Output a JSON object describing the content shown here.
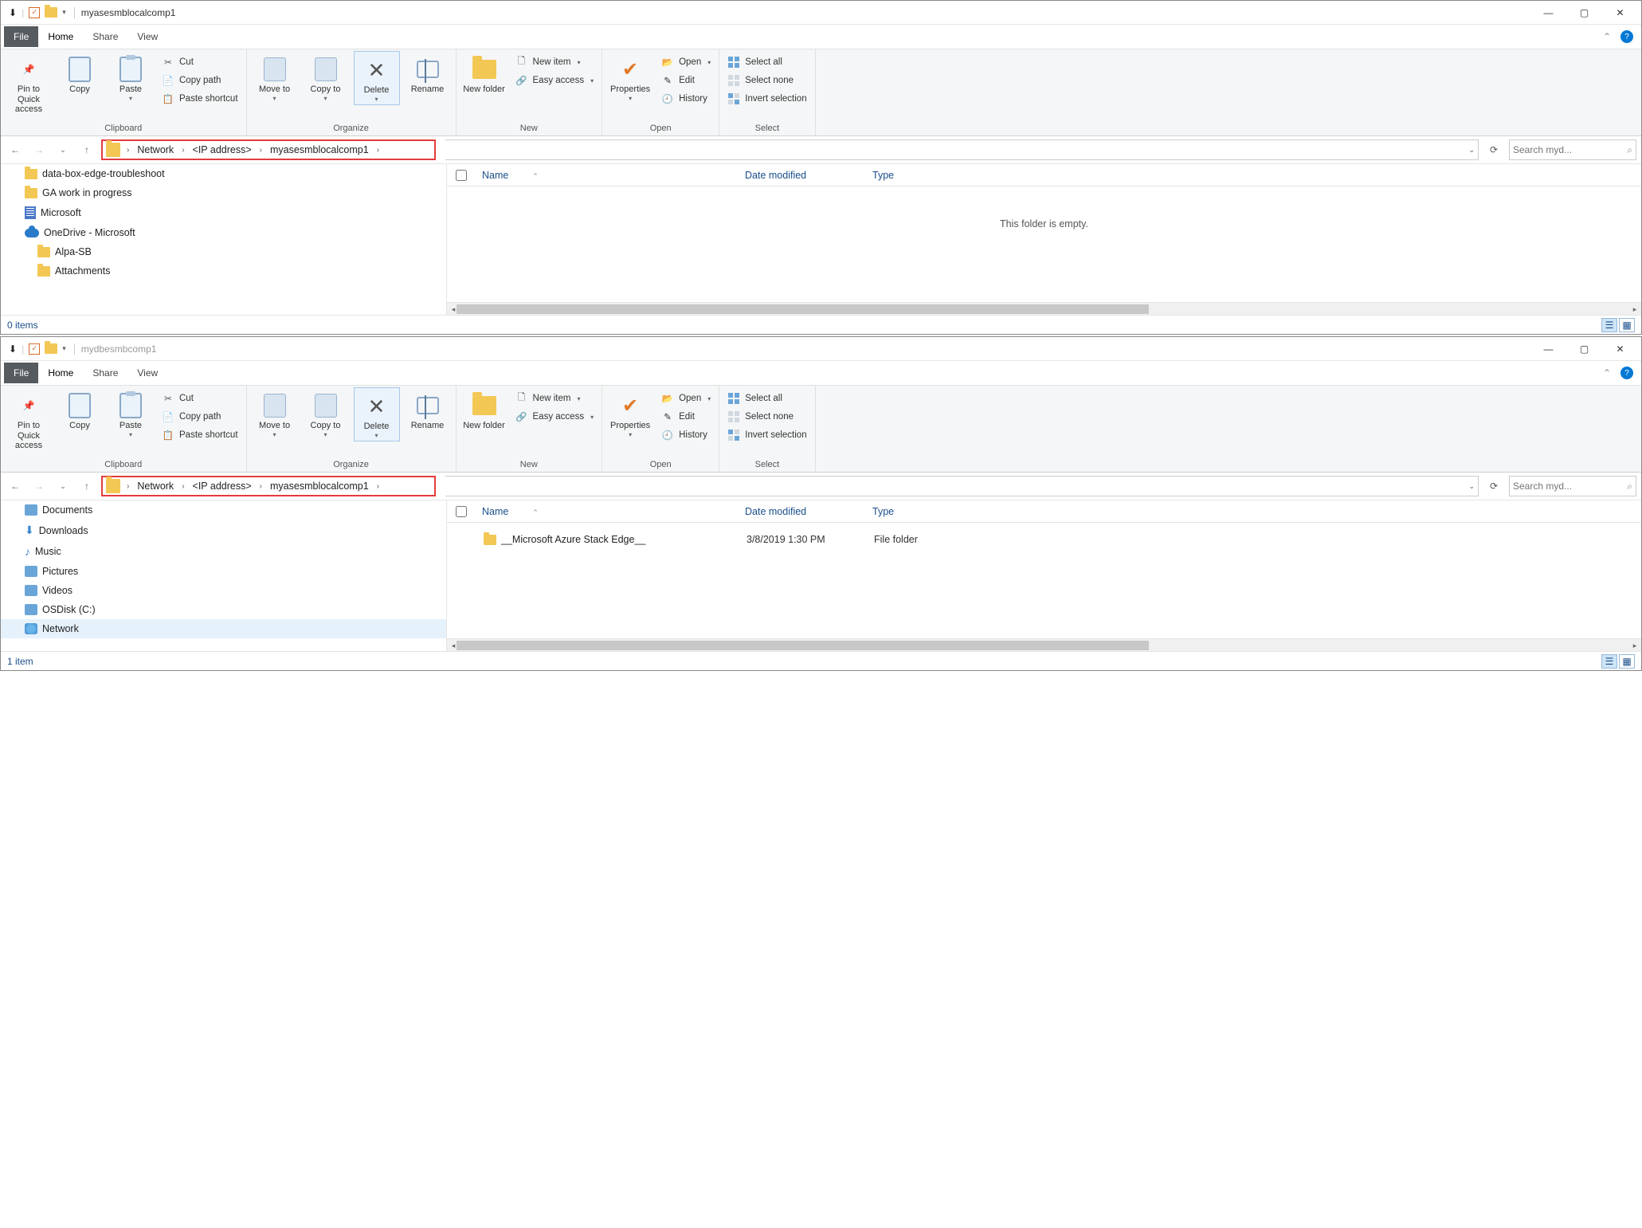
{
  "windows": [
    {
      "title": "myasesmblocalcomp1",
      "dimmed": false,
      "tabs": {
        "file": "File",
        "home": "Home",
        "share": "Share",
        "view": "View"
      },
      "ribbon": {
        "clipboard": {
          "label": "Clipboard",
          "pin": "Pin to Quick access",
          "copy": "Copy",
          "paste": "Paste",
          "cut": "Cut",
          "copypath": "Copy path",
          "pasteshortcut": "Paste shortcut"
        },
        "organize": {
          "label": "Organize",
          "moveto": "Move to",
          "copyto": "Copy to",
          "delete": "Delete",
          "rename": "Rename"
        },
        "new": {
          "label": "New",
          "newfolder": "New folder",
          "newitem": "New item",
          "easyaccess": "Easy access"
        },
        "open": {
          "label": "Open",
          "properties": "Properties",
          "open": "Open",
          "edit": "Edit",
          "history": "History"
        },
        "select": {
          "label": "Select",
          "all": "Select all",
          "none": "Select none",
          "invert": "Invert selection"
        }
      },
      "breadcrumb": [
        {
          "label": "Network"
        },
        {
          "label": "<IP address>"
        },
        {
          "label": "myasesmblocalcomp1"
        }
      ],
      "search_placeholder": "Search myd...",
      "columns": {
        "name": "Name",
        "date": "Date modified",
        "type": "Type"
      },
      "nav_items": [
        {
          "icon": "folder",
          "label": "data-box-edge-troubleshoot",
          "indent": false
        },
        {
          "icon": "folder",
          "label": "GA work in progress",
          "indent": false
        },
        {
          "icon": "building",
          "label": "Microsoft",
          "indent": false
        },
        {
          "icon": "cloud",
          "label": "OneDrive - Microsoft",
          "indent": false
        },
        {
          "icon": "folder",
          "label": "Alpa-SB",
          "indent": true
        },
        {
          "icon": "folder",
          "label": "Attachments",
          "indent": true
        }
      ],
      "empty_text": "This folder is empty.",
      "files": [],
      "status": "0 items"
    },
    {
      "title": "mydbesmbcomp1",
      "dimmed": true,
      "tabs": {
        "file": "File",
        "home": "Home",
        "share": "Share",
        "view": "View"
      },
      "ribbon": {
        "clipboard": {
          "label": "Clipboard",
          "pin": "Pin to Quick access",
          "copy": "Copy",
          "paste": "Paste",
          "cut": "Cut",
          "copypath": "Copy path",
          "pasteshortcut": "Paste shortcut"
        },
        "organize": {
          "label": "Organize",
          "moveto": "Move to",
          "copyto": "Copy to",
          "delete": "Delete",
          "rename": "Rename"
        },
        "new": {
          "label": "New",
          "newfolder": "New folder",
          "newitem": "New item",
          "easyaccess": "Easy access"
        },
        "open": {
          "label": "Open",
          "properties": "Properties",
          "open": "Open",
          "edit": "Edit",
          "history": "History"
        },
        "select": {
          "label": "Select",
          "all": "Select all",
          "none": "Select none",
          "invert": "Invert selection"
        }
      },
      "breadcrumb": [
        {
          "label": "Network"
        },
        {
          "label": "<IP address>"
        },
        {
          "label": "myasesmblocalcomp1"
        }
      ],
      "search_placeholder": "Search myd...",
      "columns": {
        "name": "Name",
        "date": "Date modified",
        "type": "Type"
      },
      "nav_items": [
        {
          "icon": "doc",
          "label": "Documents",
          "indent": false
        },
        {
          "icon": "down",
          "label": "Downloads",
          "indent": false
        },
        {
          "icon": "music",
          "label": "Music",
          "indent": false
        },
        {
          "icon": "pic",
          "label": "Pictures",
          "indent": false
        },
        {
          "icon": "vid",
          "label": "Videos",
          "indent": false
        },
        {
          "icon": "disk",
          "label": "OSDisk (C:)",
          "indent": false
        },
        {
          "icon": "net",
          "label": "Network",
          "indent": false,
          "selected": true
        }
      ],
      "empty_text": "",
      "files": [
        {
          "name": "__Microsoft Azure Stack Edge__",
          "date": "3/8/2019 1:30 PM",
          "type": "File folder"
        }
      ],
      "status": "1 item"
    }
  ]
}
